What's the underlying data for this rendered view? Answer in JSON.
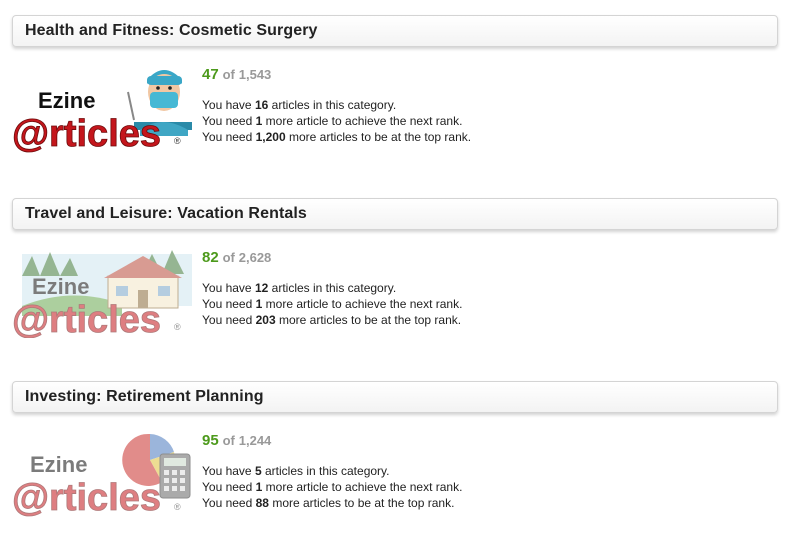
{
  "categories": [
    {
      "title": "Health and Fitness: Cosmetic Surgery",
      "rank": "47",
      "of_word": "of",
      "total": "1,543",
      "stats": [
        {
          "prefix": "You have",
          "value": "16",
          "suffix": "articles in this category."
        },
        {
          "prefix": "You need",
          "value": "1",
          "suffix": "more article to achieve the next rank."
        },
        {
          "prefix": "You need",
          "value": "1,200",
          "suffix": "more articles to be at the top rank."
        }
      ],
      "logo": {
        "line1": "Ezine",
        "line2": "@rticles",
        "mark": "®",
        "illustration": "surgeon-icon"
      }
    },
    {
      "title": "Travel and Leisure: Vacation Rentals",
      "rank": "82",
      "of_word": "of",
      "total": "2,628",
      "stats": [
        {
          "prefix": "You have",
          "value": "12",
          "suffix": "articles in this category."
        },
        {
          "prefix": "You need",
          "value": "1",
          "suffix": "more article to achieve the next rank."
        },
        {
          "prefix": "You need",
          "value": "203",
          "suffix": "more articles to be at the top rank."
        }
      ],
      "logo": {
        "line1": "Ezine",
        "line2": "@rticles",
        "mark": "®",
        "illustration": "vacation-house-icon"
      }
    },
    {
      "title": "Investing: Retirement Planning",
      "rank": "95",
      "of_word": "of",
      "total": "1,244",
      "stats": [
        {
          "prefix": "You have",
          "value": "5",
          "suffix": "articles in this category."
        },
        {
          "prefix": "You need",
          "value": "1",
          "suffix": "more article to achieve the next rank."
        },
        {
          "prefix": "You need",
          "value": "88",
          "suffix": "more articles to be at the top rank."
        }
      ],
      "logo": {
        "line1": "Ezine",
        "line2": "@rticles",
        "mark": "®",
        "illustration": "calculator-pie-icon"
      }
    }
  ],
  "colors": {
    "rank": "#4d9a1c",
    "logo_red": "#c4161c",
    "logo_dark": "#111111"
  }
}
